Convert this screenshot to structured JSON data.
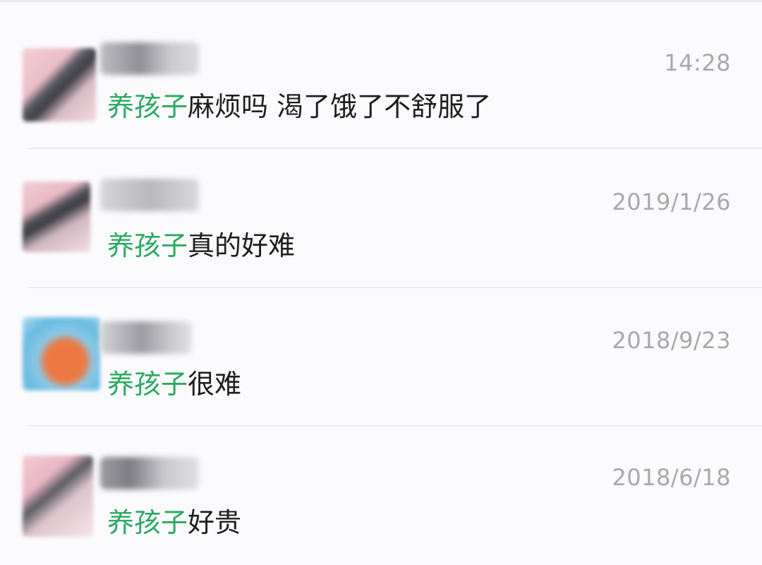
{
  "colors": {
    "keyword_highlight": "#2aaa5f",
    "message_text": "#1e1e1e",
    "timestamp_text": "#a9a9ad",
    "background": "#fbfbfd"
  },
  "results": [
    {
      "keyword": "养孩子",
      "message_rest": "麻烦吗  渴了饿了不舒服了",
      "time": "14:28"
    },
    {
      "keyword": "养孩子",
      "message_rest": "真的好难",
      "time": "2019/1/26"
    },
    {
      "keyword": "养孩子",
      "message_rest": "很难",
      "time": "2018/9/23"
    },
    {
      "keyword": "养孩子",
      "message_rest": "好贵",
      "time": "2018/6/18"
    }
  ]
}
